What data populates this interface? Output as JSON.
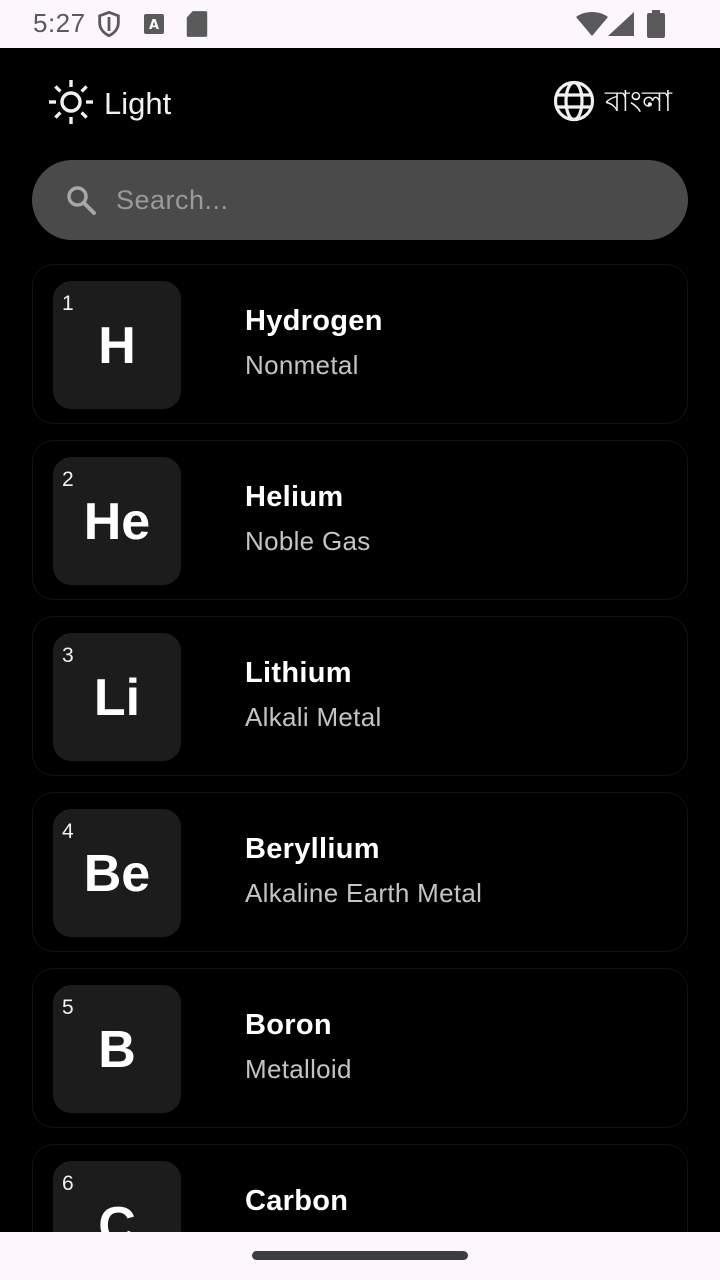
{
  "status_bar": {
    "time": "5:27",
    "icons": [
      "shield-icon",
      "font-download-icon",
      "sd-card-icon",
      "wifi-icon",
      "signal-icon",
      "battery-icon"
    ]
  },
  "header": {
    "theme_label": "Light",
    "theme_icon": "sun-icon",
    "language_label": "বাংলা",
    "language_icon": "globe-icon"
  },
  "search": {
    "placeholder": "Search...",
    "value": ""
  },
  "elements": [
    {
      "number": "1",
      "symbol": "H",
      "name": "Hydrogen",
      "category": "Nonmetal"
    },
    {
      "number": "2",
      "symbol": "He",
      "name": "Helium",
      "category": "Noble Gas"
    },
    {
      "number": "3",
      "symbol": "Li",
      "name": "Lithium",
      "category": "Alkali Metal"
    },
    {
      "number": "4",
      "symbol": "Be",
      "name": "Beryllium",
      "category": "Alkaline Earth Metal"
    },
    {
      "number": "5",
      "symbol": "B",
      "name": "Boron",
      "category": "Metalloid"
    },
    {
      "number": "6",
      "symbol": "C",
      "name": "Carbon",
      "category": ""
    }
  ],
  "colors": {
    "background": "#000000",
    "tile": "#1c1c1c",
    "search_bg": "#4a4a4a",
    "system_bar": "#fdf7fd"
  }
}
